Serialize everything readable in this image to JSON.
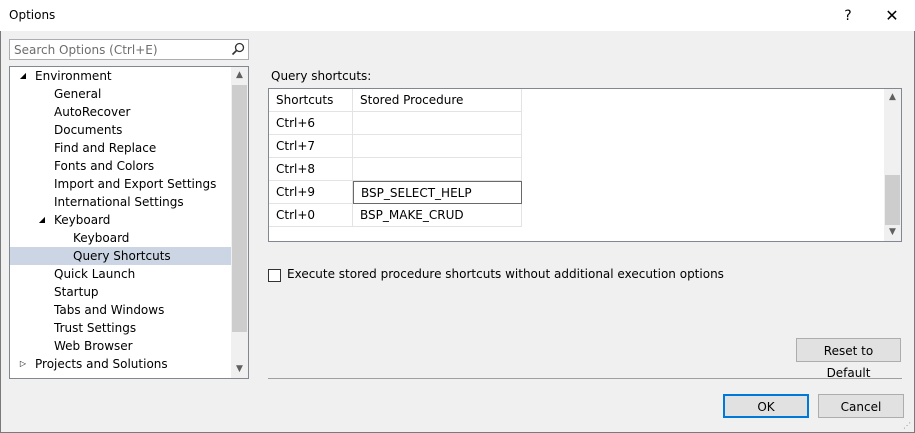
{
  "window": {
    "title": "Options",
    "help_glyph": "?",
    "close_glyph": "✕"
  },
  "search": {
    "placeholder": "Search Options (Ctrl+E)"
  },
  "tree": {
    "items": [
      {
        "label": "Environment",
        "level": 0,
        "expander": "expanded"
      },
      {
        "label": "General",
        "level": 1
      },
      {
        "label": "AutoRecover",
        "level": 1
      },
      {
        "label": "Documents",
        "level": 1
      },
      {
        "label": "Find and Replace",
        "level": 1
      },
      {
        "label": "Fonts and Colors",
        "level": 1
      },
      {
        "label": "Import and Export Settings",
        "level": 1
      },
      {
        "label": "International Settings",
        "level": 1
      },
      {
        "label": "Keyboard",
        "level": 1,
        "expander": "expanded"
      },
      {
        "label": "Keyboard",
        "level": 2
      },
      {
        "label": "Query Shortcuts",
        "level": 2,
        "selected": true
      },
      {
        "label": "Quick Launch",
        "level": 1
      },
      {
        "label": "Startup",
        "level": 1
      },
      {
        "label": "Tabs and Windows",
        "level": 1
      },
      {
        "label": "Trust Settings",
        "level": 1
      },
      {
        "label": "Web Browser",
        "level": 1
      },
      {
        "label": "Projects and Solutions",
        "level": 0,
        "expander": "collapsed"
      }
    ]
  },
  "query_shortcuts": {
    "label": "Query shortcuts:",
    "columns": [
      "Shortcuts",
      "Stored Procedure"
    ],
    "rows": [
      {
        "shortcut": "Ctrl+6",
        "procedure": ""
      },
      {
        "shortcut": "Ctrl+7",
        "procedure": ""
      },
      {
        "shortcut": "Ctrl+8",
        "procedure": ""
      },
      {
        "shortcut": "Ctrl+9",
        "procedure": "BSP_SELECT_HELP",
        "editing": true
      },
      {
        "shortcut": "Ctrl+0",
        "procedure": "BSP_MAKE_CRUD"
      }
    ]
  },
  "options": {
    "execute_checkbox_label": "Execute stored procedure shortcuts without additional execution options",
    "execute_checked": false
  },
  "buttons": {
    "reset": "Reset to Default",
    "ok": "OK",
    "cancel": "Cancel"
  },
  "colors": {
    "selection": "#ccd5e3",
    "focus_border": "#0078d7"
  }
}
